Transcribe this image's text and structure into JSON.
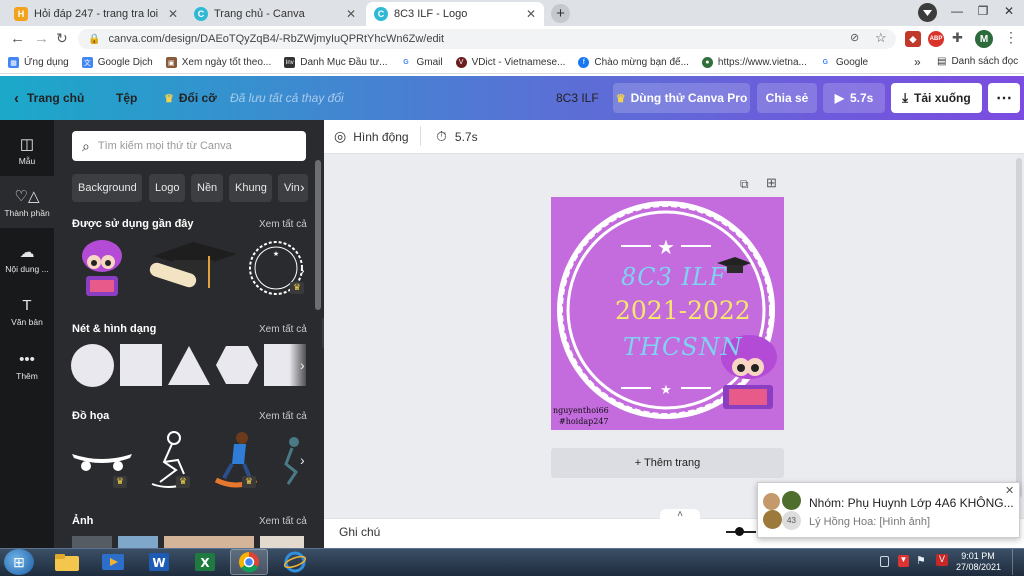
{
  "browser": {
    "tabs": [
      {
        "title": "Hỏi đáp 247 - trang tra loi",
        "favicon": "H"
      },
      {
        "title": "Trang chủ - Canva",
        "favicon": "C"
      },
      {
        "title": "8C3 ILF - Logo",
        "favicon": "C"
      }
    ],
    "url": "canva.com/design/DAEoTQyZqB4/-RbZWjmyIuQPRtYhcWn6Zw/edit",
    "profile_initial": "M",
    "abp_label": "ABP",
    "bookmarks": [
      "Ứng dụng",
      "Google Dịch",
      "Xem ngày tốt theo...",
      "Danh Mục Đầu tư...",
      "Gmail",
      "VDict - Vietnamese...",
      "Chào mừng bạn đế...",
      "https://www.vietna...",
      "Google"
    ],
    "bookmark_icon_labels": [
      "Inv",
      "G",
      "V",
      "G"
    ],
    "more_bookmarks": "»",
    "reading_list": "Danh sách đọc"
  },
  "canva": {
    "home": "Trang chủ",
    "file": "Tệp",
    "resize": "Đổi cỡ",
    "saved_status": "Đã lưu tất cả thay đổi",
    "design_title": "8C3 ILF",
    "try_pro": "Dùng thử Canva Pro",
    "share": "Chia sẻ",
    "play_duration": "5.7s",
    "download": "Tải xuống",
    "rail": [
      {
        "label": "Mẫu",
        "icon": "template-icon"
      },
      {
        "label": "Thành phần",
        "icon": "elements-icon"
      },
      {
        "label": "Nội dung ...",
        "icon": "upload-cloud-icon"
      },
      {
        "label": "Văn bản",
        "icon": "text-icon"
      },
      {
        "label": "Thêm",
        "icon": "more-icon"
      }
    ],
    "search_placeholder": "Tìm kiếm mọi thứ từ Canva",
    "chips": [
      "Background",
      "Logo",
      "Nền",
      "Khung",
      "Vin"
    ],
    "sections": {
      "recent": "Được sử dụng gần đây",
      "lines_shapes": "Nét & hình dạng",
      "graphics": "Đồ họa",
      "photos": "Ảnh",
      "see_all": "Xem tất cả"
    },
    "animate": "Hình động",
    "timer": "5.7s",
    "add_page": "+ Thêm trang",
    "notes": "Ghi chú",
    "design": {
      "line1": "8C3 ILF",
      "line2": "2021-2022",
      "line3": "THCSNN",
      "credit1": "nguyenthoi66",
      "credit2": "#hoidap247"
    }
  },
  "notification": {
    "title": "Nhóm: Phụ Huynh Lớp 4A6 KHÔNG...",
    "message": "Lý Hồng Hoa: [Hình ảnh]",
    "badge": "43"
  },
  "taskbar": {
    "time": "9:01 PM",
    "date": "27/08/2021"
  },
  "colors": {
    "design_bg": "#c46bde",
    "design_year": "#f5e86a",
    "design_text": "#7fd3f0",
    "header_start": "#1ba9c9",
    "header_end": "#7b4ce0"
  }
}
